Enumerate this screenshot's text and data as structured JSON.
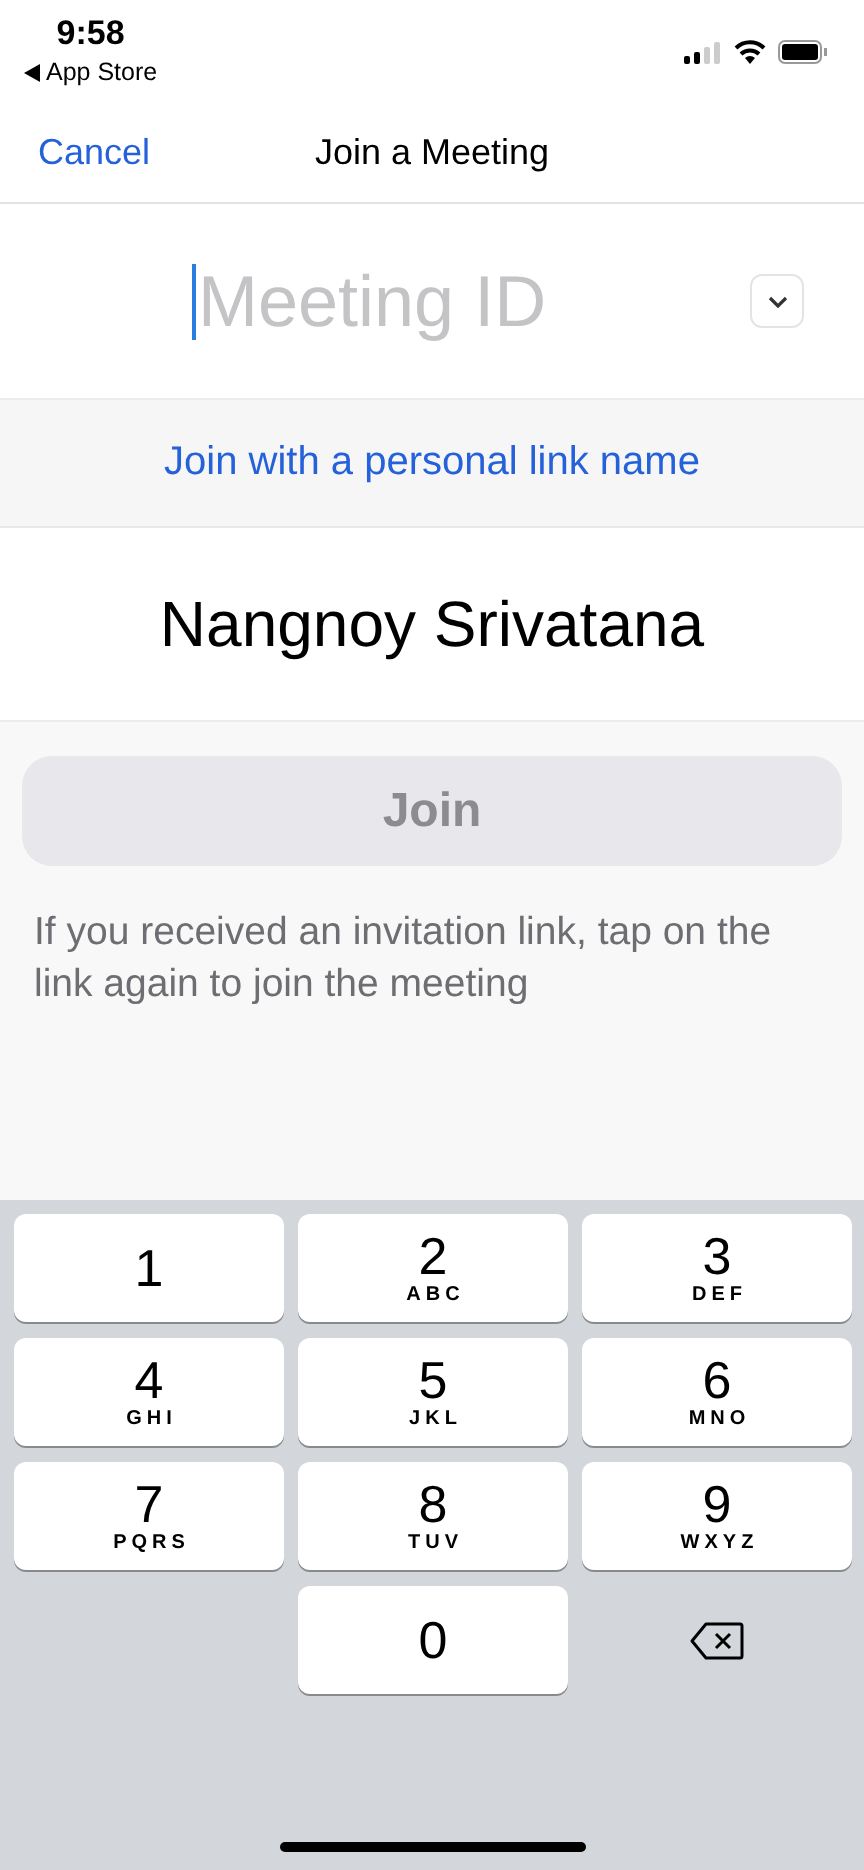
{
  "status_bar": {
    "time": "9:58",
    "back_label": "App Store"
  },
  "nav": {
    "cancel": "Cancel",
    "title": "Join a Meeting"
  },
  "meeting_id": {
    "placeholder": "Meeting ID",
    "focused": true
  },
  "personal_link": "Join with a personal link name",
  "name_field": {
    "value": "Nangnoy Srivatana"
  },
  "join_button": {
    "label": "Join",
    "disabled": true
  },
  "info": "If you received an invitation link, tap on the link again to join the meeting",
  "keypad": [
    {
      "kind": "digit",
      "digit": "1"
    },
    {
      "kind": "digit",
      "digit": "2",
      "letters": "ABC"
    },
    {
      "kind": "digit",
      "digit": "3",
      "letters": "DEF"
    },
    {
      "kind": "digit",
      "digit": "4",
      "letters": "GHI"
    },
    {
      "kind": "digit",
      "digit": "5",
      "letters": "JKL"
    },
    {
      "kind": "digit",
      "digit": "6",
      "letters": "MNO"
    },
    {
      "kind": "digit",
      "digit": "7",
      "letters": "PQRS"
    },
    {
      "kind": "digit",
      "digit": "8",
      "letters": "TUV"
    },
    {
      "kind": "digit",
      "digit": "9",
      "letters": "WXYZ"
    },
    {
      "kind": "spacer"
    },
    {
      "kind": "digit",
      "digit": "0"
    },
    {
      "kind": "delete"
    }
  ]
}
